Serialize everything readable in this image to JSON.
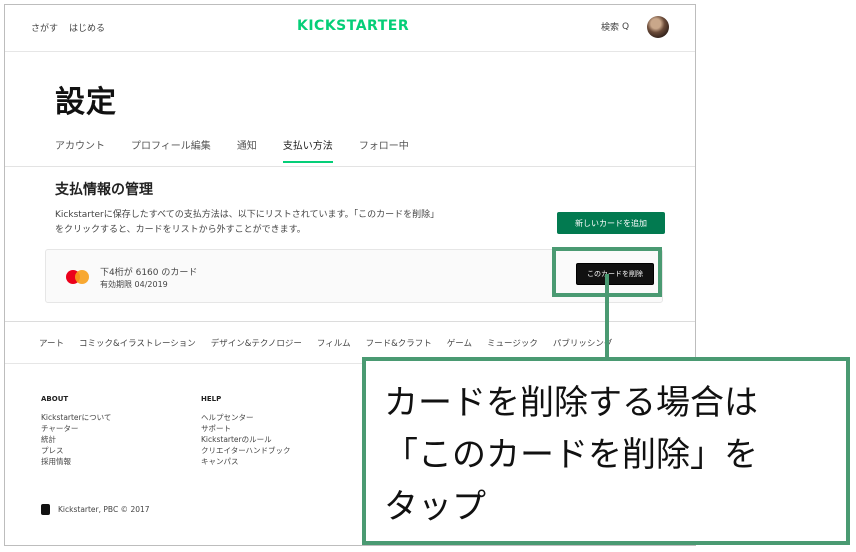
{
  "topnav": {
    "explore": "さがす",
    "start": "はじめる",
    "logo": "KICKSTARTER",
    "search_label": "検索",
    "search_icon_glyph": "Q"
  },
  "settings": {
    "title": "設定",
    "tabs": [
      {
        "label": "アカウント"
      },
      {
        "label": "プロフィール編集"
      },
      {
        "label": "通知"
      },
      {
        "label": "支払い方法"
      },
      {
        "label": "フォロー中"
      }
    ],
    "active_tab": "支払い方法"
  },
  "payment": {
    "section_title": "支払情報の管理",
    "description": "Kickstarterに保存したすべての支払方法は、以下にリストされています。「このカードを削除」をクリックすると、カードをリストから外すことができます。",
    "add_card_label": "新しいカードを追加",
    "card": {
      "number_text": "下4桁が 6160 のカード",
      "expiry_text": "有効期限 04/2019",
      "remove_label": "このカードを削除"
    }
  },
  "categories": [
    "アート",
    "コミック&イラストレーション",
    "デザイン&テクノロジー",
    "フィルム",
    "フード&クラフト",
    "ゲーム",
    "ミュージック",
    "パブリッシング"
  ],
  "footer": {
    "about": {
      "title": "ABOUT",
      "links": [
        "Kickstarterについて",
        "チャーター",
        "統計",
        "プレス",
        "採用情報"
      ]
    },
    "help": {
      "title": "HELP",
      "links": [
        "ヘルプセンター",
        "サポート",
        "Kickstarterのルール",
        "クリエイターハンドブック",
        "キャンパス"
      ]
    },
    "copyright": "Kickstarter, PBC © 2017"
  },
  "callout": {
    "lines": [
      "カードを削除する場合は",
      "「このカードを削除」を",
      "タップ"
    ]
  },
  "colors": {
    "brand_green": "#05ce78",
    "button_green": "#027a50",
    "callout_green": "#4a9a72"
  }
}
